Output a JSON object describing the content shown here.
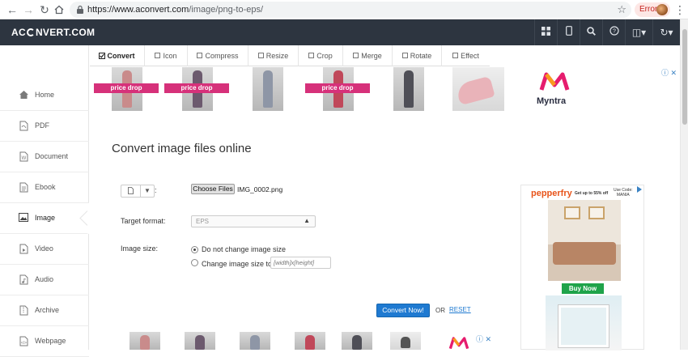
{
  "browser": {
    "url_host": "https://www.aconvert.com",
    "url_path": "/image/png-to-eps/",
    "error_label": "Error"
  },
  "header": {
    "logo_left": "AC",
    "logo_right": "NVERT.COM"
  },
  "sidebar": {
    "items": [
      {
        "label": "Home",
        "icon": "home-icon"
      },
      {
        "label": "PDF",
        "icon": "pdf-icon"
      },
      {
        "label": "Document",
        "icon": "document-icon"
      },
      {
        "label": "Ebook",
        "icon": "ebook-icon"
      },
      {
        "label": "Image",
        "icon": "image-icon"
      },
      {
        "label": "Video",
        "icon": "video-icon"
      },
      {
        "label": "Audio",
        "icon": "audio-icon"
      },
      {
        "label": "Archive",
        "icon": "archive-icon"
      },
      {
        "label": "Webpage",
        "icon": "webpage-icon"
      }
    ]
  },
  "tabs": [
    {
      "label": "Convert"
    },
    {
      "label": "Icon"
    },
    {
      "label": "Compress"
    },
    {
      "label": "Resize"
    },
    {
      "label": "Crop"
    },
    {
      "label": "Merge"
    },
    {
      "label": "Rotate"
    },
    {
      "label": "Effect"
    }
  ],
  "ads": {
    "price_tag": "price drop",
    "myntra": "Myntra",
    "pepperfry": "pepperfry",
    "pepperfry_offer": "Get up to 55% off",
    "pepperfry_code_line1": "Use Code:",
    "pepperfry_code_line2": "MANIA",
    "buy_now": "Buy Now"
  },
  "main": {
    "title": "Convert image files online",
    "colon": ":",
    "choose_files": "Choose Files",
    "file_name": "IMG_0002.png",
    "target_format_label": "Target format:",
    "target_format_value": "EPS",
    "image_size_label": "Image size:",
    "size_option_1": "Do not change image size",
    "size_option_2": "Change image size to:",
    "size_placeholder": "[width]x[height]",
    "convert_button": "Convert Now!",
    "or_text": "OR",
    "reset_text": "RESET"
  },
  "colors": {
    "topbar": "#2d3540",
    "accent_blue": "#1f7ad1",
    "price_pink": "#d6317a",
    "buy_green": "#1fa34a"
  }
}
